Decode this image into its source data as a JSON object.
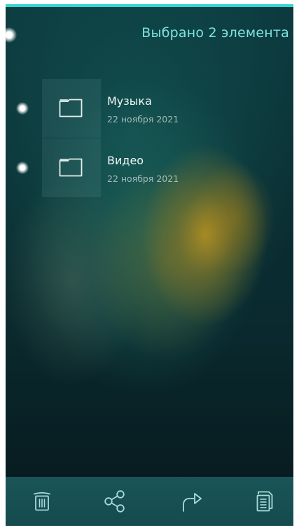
{
  "header": {
    "title": "Выбрано 2 элемента"
  },
  "items": [
    {
      "name": "Музыка",
      "date": "22 ноября 2021",
      "icon": "folder-icon",
      "selected": true
    },
    {
      "name": "Видео",
      "date": "22 ноября 2021",
      "icon": "folder-icon",
      "selected": true
    }
  ],
  "toolbar": {
    "icons": [
      "trash-icon",
      "share-icon",
      "move-icon",
      "copy-icon"
    ]
  },
  "colors": {
    "accent": "#36d4d0",
    "title": "#7ee3e0",
    "toolbar_bg": "#1a5558"
  }
}
